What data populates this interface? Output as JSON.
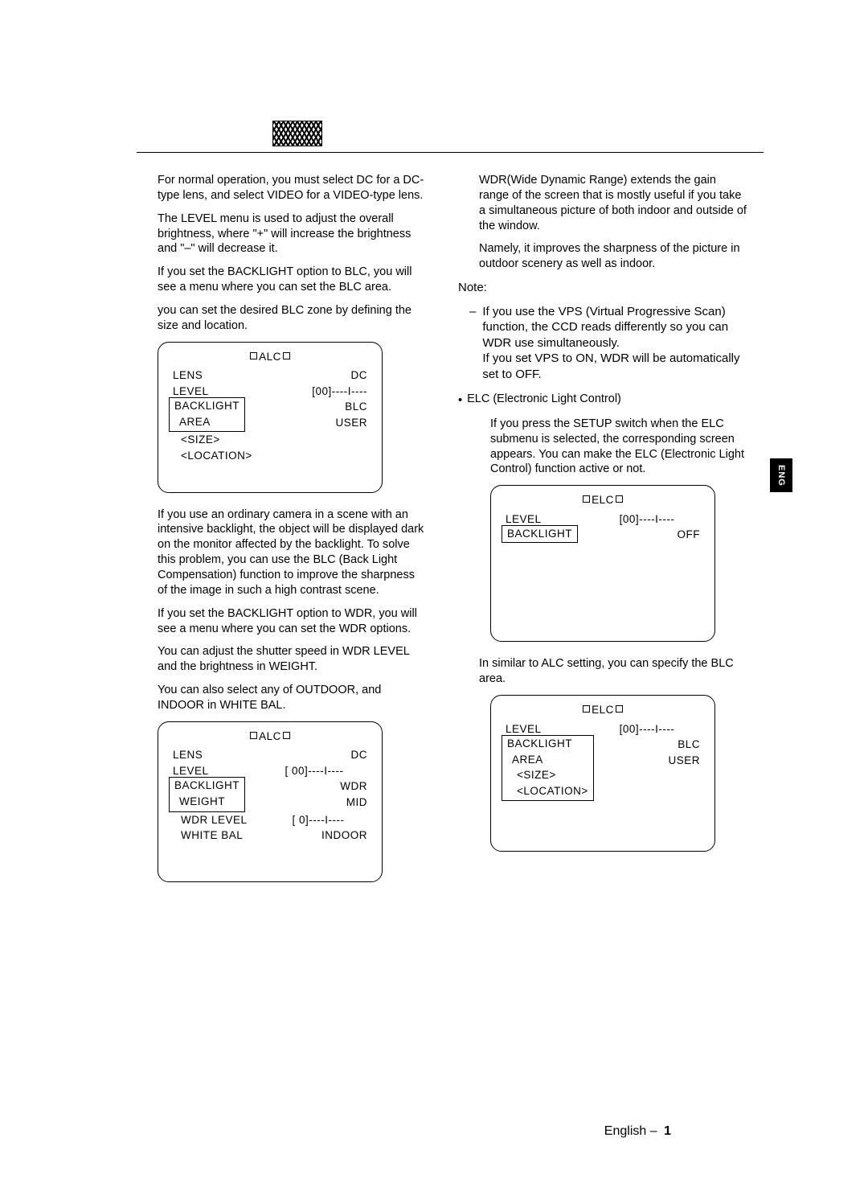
{
  "left": {
    "p1": "For normal operation, you must select DC for a DC-type lens, and select VIDEO for a VIDEO-type lens.",
    "p2": "The LEVEL menu is used to adjust the overall brightness, where \"+\" will increase the brightness and \"–\" will decrease it.",
    "p3": "If you set the BACKLIGHT option to BLC, you will see a menu where you can set the BLC area.",
    "p4": "you can set the desired BLC zone by defining the size and location.",
    "p5": "If you use an ordinary camera in a scene with an intensive backlight, the object will be displayed dark on the monitor affected by the backlight. To solve this problem, you can use the BLC (Back Light Compensation) function to improve the sharpness of the image in such a high contrast scene.",
    "p6": "If you set the BACKLIGHT option to WDR, you will see a menu where you can set the WDR options.",
    "p7": "You can adjust the shutter speed in WDR LEVEL and the brightness in WEIGHT.",
    "p8": "You can also select any of OUTDOOR, and INDOOR in WHITE BAL.",
    "menu1": {
      "title": "ALC",
      "lens": "LENS",
      "lens_v": "DC",
      "level": "LEVEL",
      "level_v": "[00]----I----",
      "backlight": "BACKLIGHT",
      "backlight_v": "BLC",
      "area": "AREA",
      "area_v": "USER",
      "size": "<SIZE>",
      "location": "<LOCATION>"
    },
    "menu2": {
      "title": "ALC",
      "lens": "LENS",
      "lens_v": "DC",
      "level": "LEVEL",
      "level_v": "[ 00]----I----",
      "backlight": "BACKLIGHT",
      "backlight_v": "WDR",
      "weight": "WEIGHT",
      "weight_v": "MID",
      "wdrlevel": "WDR LEVEL",
      "wdrlevel_v": "[ 0]----I----",
      "whitebal": "WHITE BAL",
      "whitebal_v": "INDOOR"
    }
  },
  "right": {
    "p1": "WDR(Wide Dynamic Range) extends the gain range of the screen that is mostly useful if you take a simultaneous picture of both indoor and outside of the window.",
    "p2": "Namely, it improves the sharpness of the picture in outdoor scenery as well as indoor.",
    "note_label": "Note:",
    "note1a": "If you use the",
    "note1b": "VPS",
    "note1c": "(Virtual Progressive Scan) function, the CCD reads differently so you can WDR use simultaneously.",
    "note2a": "If you set",
    "note2b": "VPS",
    "note2c": "to",
    "note2d": "ON, WDR",
    "note2e": "will be automatically set to OFF.",
    "elc_label": "ELC (Electronic Light Control)",
    "p3": "If you press the SETUP switch when the ELC submenu is selected, the corresponding screen appears. You can make the ELC (Electronic Light Control) function active or not.",
    "p4": "In similar to ALC setting, you can specify the BLC area.",
    "menu1": {
      "title": "ELC",
      "level": "LEVEL",
      "level_v": "[00]----I----",
      "backlight": "BACKLIGHT",
      "backlight_v": "OFF"
    },
    "menu2": {
      "title": "ELC",
      "level": "LEVEL",
      "level_v": "[00]----I----",
      "backlight": "BACKLIGHT",
      "backlight_v": "BLC",
      "area": "AREA",
      "area_v": "USER",
      "size": "<SIZE>",
      "location": "<LOCATION>"
    }
  },
  "side_tab": "ENG",
  "footer_lang": "English",
  "footer_page": "1"
}
